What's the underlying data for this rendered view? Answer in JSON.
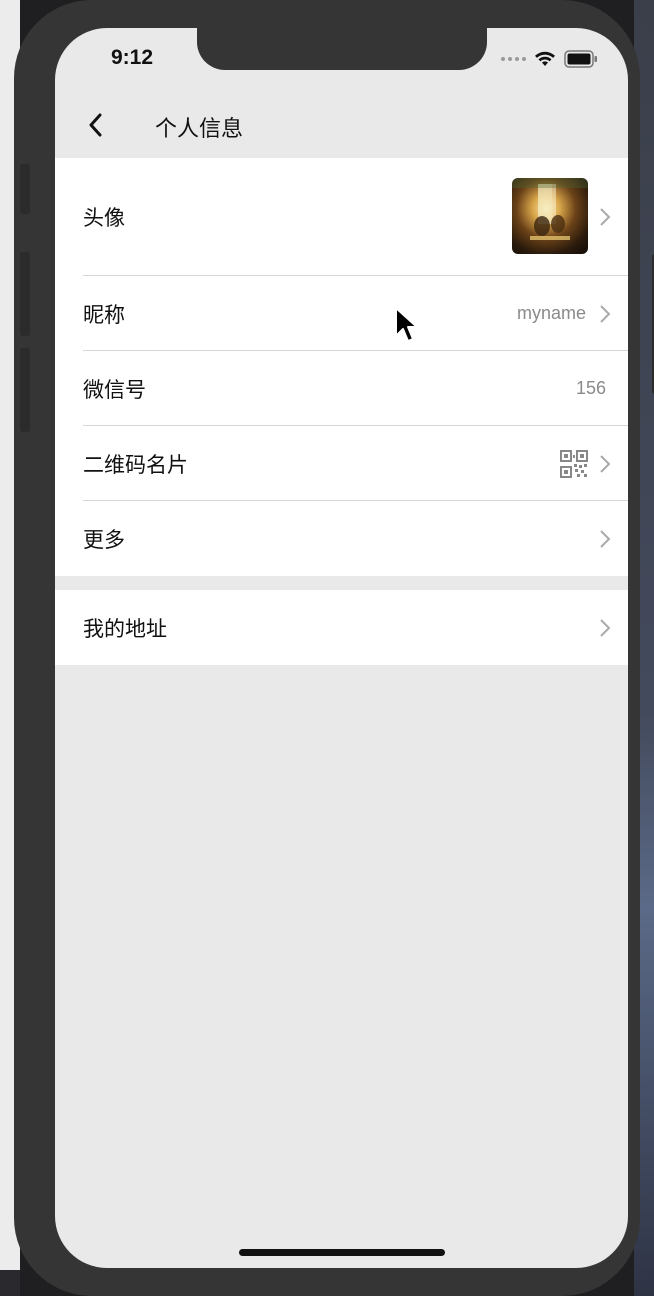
{
  "status_bar": {
    "time": "9:12"
  },
  "nav": {
    "title": "个人信息"
  },
  "rows": [
    {
      "label": "头像"
    },
    {
      "label": "昵称",
      "value": "myname"
    },
    {
      "label": "微信号",
      "value": "156"
    },
    {
      "label": "二维码名片"
    },
    {
      "label": "更多"
    }
  ],
  "address_row": {
    "label": "我的地址"
  },
  "icons": {
    "back": "chevron-left-icon",
    "chevron": "chevron-right-icon",
    "qr": "qr-code-icon",
    "wifi": "wifi-icon",
    "battery": "battery-icon",
    "signal": "signal-icon",
    "cursor": "mouse-cursor-icon"
  },
  "colors": {
    "background": "#e9e9e9",
    "card": "#ffffff",
    "secondary_text": "#8a8a8a"
  }
}
